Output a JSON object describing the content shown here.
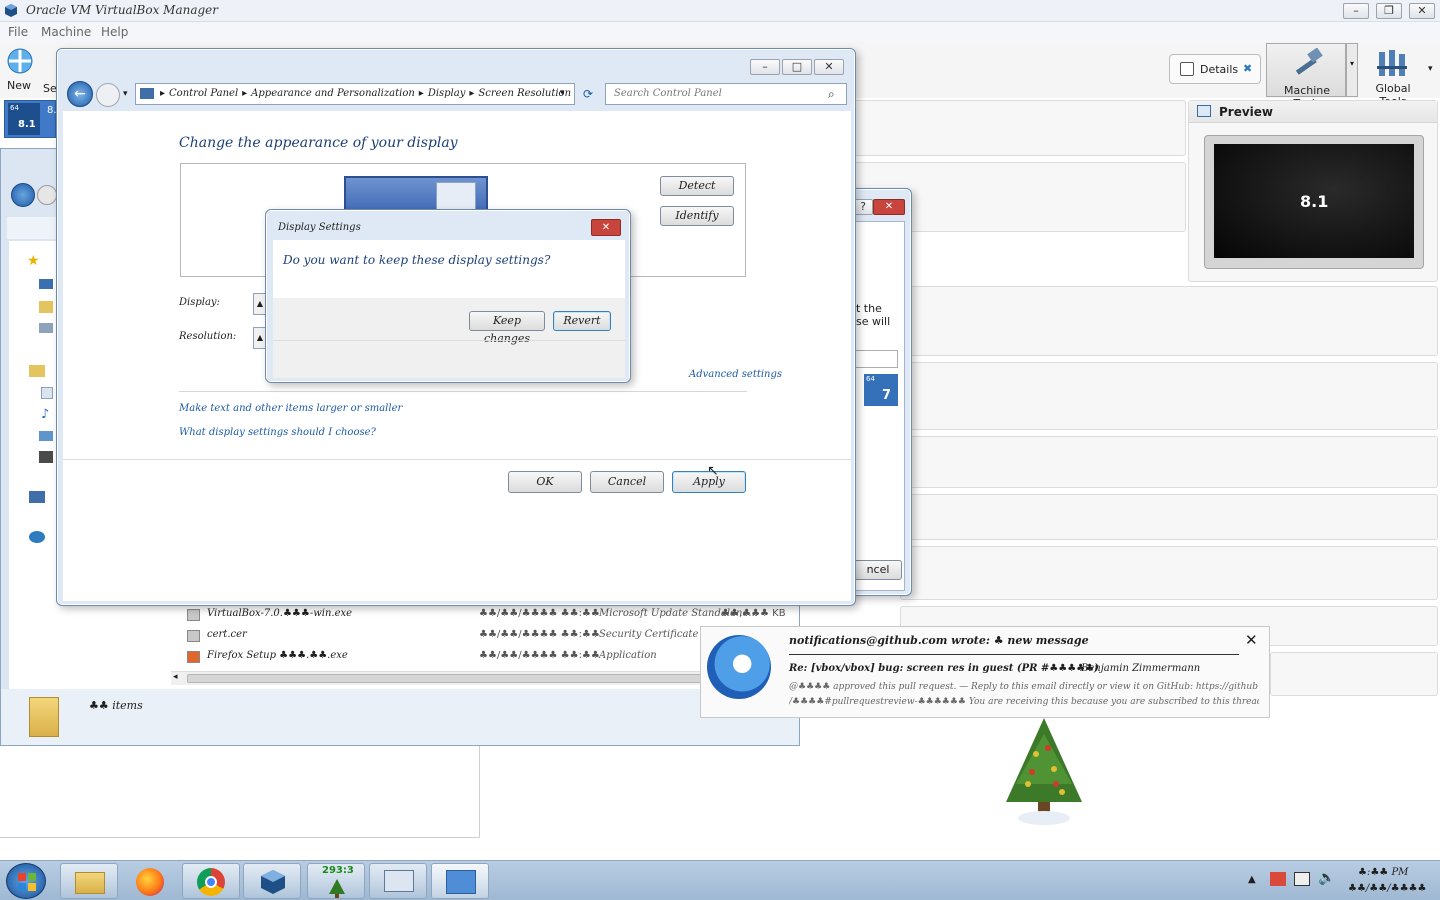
{
  "vbox": {
    "title": "Oracle VM VirtualBox Manager",
    "menu": [
      "File",
      "Machine",
      "Help"
    ],
    "toolbar": {
      "new_label": "New",
      "settings_label": "Se",
      "details_label": "Details",
      "machine_tools_label": "Machine Tools",
      "global_tools_label": "Global Tools"
    },
    "vm_badge": "8.1",
    "vm_badge_small": "64",
    "preview_title": "Preview",
    "preview_text": "8.1",
    "side_vm_badge": "7",
    "behind_dialog_text1": "t the",
    "behind_dialog_text2": "se will",
    "behind_dialog_cancel": "ncel",
    "status_bar_items": "♣♣ items"
  },
  "display_window": {
    "breadcrumb": [
      "Control Panel",
      "Appearance and Personalization",
      "Display",
      "Screen Resolution"
    ],
    "search_placeholder": "Search Control Panel",
    "heading": "Change the appearance of your display",
    "detect_label": "Detect",
    "identify_label": "Identify",
    "display_label": "Display:",
    "resolution_label": "Resolution:",
    "advanced_link": "Advanced settings",
    "link1": "Make text and other items larger or smaller",
    "link2": "What display settings should I choose?",
    "ok_label": "OK",
    "cancel_label": "Cancel",
    "apply_label": "Apply"
  },
  "confirm_dialog": {
    "title": "Display Settings",
    "question": "Do you want to keep these display settings?",
    "keep_label": "Keep changes",
    "revert_label": "Revert"
  },
  "explorer_rows": [
    {
      "name": "VirtualBox-7.0.♣♣♣-win.exe",
      "date": "♣♣/♣♣/♣♣♣♣ ♣♣:♣♣",
      "type": "Microsoft Update Standalone...",
      "size": "♣♣,♣♣♣ KB"
    },
    {
      "name": "cert.cer",
      "date": "♣♣/♣♣/♣♣♣♣ ♣♣:♣♣",
      "type": "Security Certificate",
      "size": ""
    },
    {
      "name": "Firefox Setup ♣♣♣.♣♣.exe",
      "date": "♣♣/♣♣/♣♣♣♣ ♣♣:♣♣",
      "type": "Application",
      "size": ""
    }
  ],
  "notification": {
    "from": "notifications@github.com wrote: ♣ new message",
    "subject": "Re: [vbox/vbox] bug: screen res in guest (PR #♣♣♣♣♣)",
    "author": "Benjamin Zimmermann",
    "body_line1": "@♣♣♣♣ approved this pull request. — Reply to this email directly or view it on GitHub: https://github.com/vbox/vbox/pull",
    "body_line2": "/♣♣♣♣#pullrequestreview-♣♣♣♣♣♣ You are receiving this because you are subscribed to this thread. Message"
  },
  "taskbar": {
    "tray_time": "♣:♣♣ PM",
    "tray_date": "♣♣/♣♣/♣♣♣♣",
    "tree_counter": "293:3"
  },
  "colors": {
    "accent": "#1c5aa6",
    "title_bar": "#dfe9f5",
    "taskbar": "#a9c1da"
  }
}
